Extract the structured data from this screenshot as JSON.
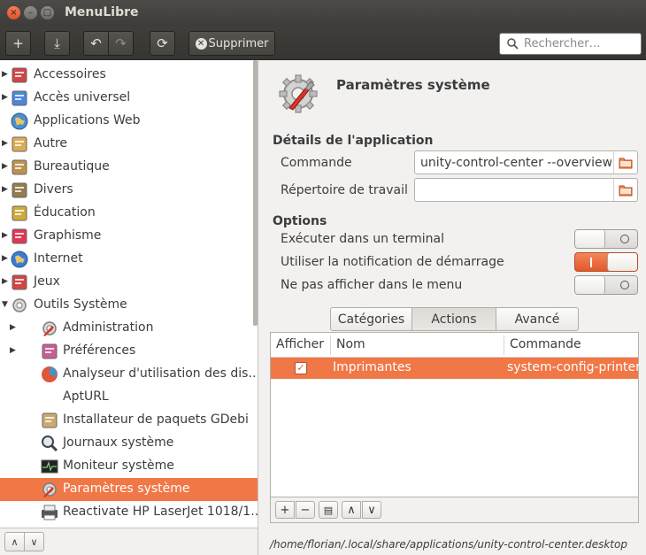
{
  "window": {
    "title": "MenuLibre",
    "close_glyph": "×",
    "minimize_glyph": "–",
    "maximize_glyph": "□"
  },
  "toolbar": {
    "add_icon": "+",
    "save_icon": "⤓",
    "undo_icon": "↶",
    "redo_icon": "↷",
    "revert_icon": "⟳",
    "delete_icon": "✕",
    "delete_label": "Supprimer",
    "search_placeholder": "Rechercher…"
  },
  "sidebar": {
    "items": [
      {
        "label": "Accessoires",
        "expander": "▶",
        "icon": "accessories-icon"
      },
      {
        "label": "Accès universel",
        "expander": "▶",
        "icon": "universal-access-icon"
      },
      {
        "label": "Applications Web",
        "expander": "",
        "icon": "web-apps-icon"
      },
      {
        "label": "Autre",
        "expander": "▶",
        "icon": "other-icon"
      },
      {
        "label": "Bureautique",
        "expander": "▶",
        "icon": "office-icon"
      },
      {
        "label": "Divers",
        "expander": "▶",
        "icon": "misc-icon"
      },
      {
        "label": "Éducation",
        "expander": "",
        "icon": "education-icon"
      },
      {
        "label": "Graphisme",
        "expander": "▶",
        "icon": "graphics-icon"
      },
      {
        "label": "Internet",
        "expander": "▶",
        "icon": "internet-icon"
      },
      {
        "label": "Jeux",
        "expander": "▶",
        "icon": "games-icon"
      },
      {
        "label": "Outils Système",
        "expander": "▼",
        "icon": "system-tools-icon"
      },
      {
        "label": "Administration",
        "expander": "▶",
        "icon": "administration-icon"
      },
      {
        "label": "Préférences",
        "expander": "▶",
        "icon": "preferences-icon"
      },
      {
        "label": "Analyseur d'utilisation des dis…",
        "expander": "",
        "icon": "disk-usage-icon"
      },
      {
        "label": "AptURL",
        "expander": "",
        "icon": "apturl-icon"
      },
      {
        "label": "Installateur de paquets GDebi",
        "expander": "",
        "icon": "gdebi-icon"
      },
      {
        "label": "Journaux système",
        "expander": "",
        "icon": "system-log-icon"
      },
      {
        "label": "Moniteur système",
        "expander": "",
        "icon": "system-monitor-icon"
      },
      {
        "label": "Paramètres système",
        "expander": "",
        "icon": "system-settings-icon"
      },
      {
        "label": "Reactivate HP LaserJet 1018/1…",
        "expander": "",
        "icon": "printer-icon"
      }
    ],
    "footer": {
      "up_icon": "∧",
      "down_icon": "∨"
    }
  },
  "app": {
    "name": "Paramètres système",
    "details_heading": "Détails de l'application",
    "command_label": "Commande",
    "command_value": "unity-control-center --overview",
    "workdir_label": "Répertoire de travail",
    "workdir_value": "",
    "options_heading": "Options",
    "options": [
      {
        "label": "Exécuter dans un terminal",
        "on": false
      },
      {
        "label": "Utiliser la notification de démarrage",
        "on": true
      },
      {
        "label": "Ne pas afficher dans le menu",
        "on": false
      }
    ]
  },
  "tabs": [
    {
      "label": "Catégories",
      "active": false
    },
    {
      "label": "Actions",
      "active": true
    },
    {
      "label": "Avancé",
      "active": false
    }
  ],
  "actions_table": {
    "columns": [
      "Afficher",
      "Nom",
      "Commande"
    ],
    "rows": [
      {
        "show": true,
        "name": "Imprimantes",
        "command": "system-config-printer"
      }
    ],
    "buttons": {
      "add": "+",
      "remove": "−",
      "edit": "▤",
      "up": "∧",
      "down": "∨"
    }
  },
  "status": {
    "path": "/home/florian/.local/share/applications/unity-control-center.desktop"
  },
  "colors": {
    "accent": "#f07746",
    "titlebar": "#3d3c38",
    "background": "#f2f1f0"
  }
}
